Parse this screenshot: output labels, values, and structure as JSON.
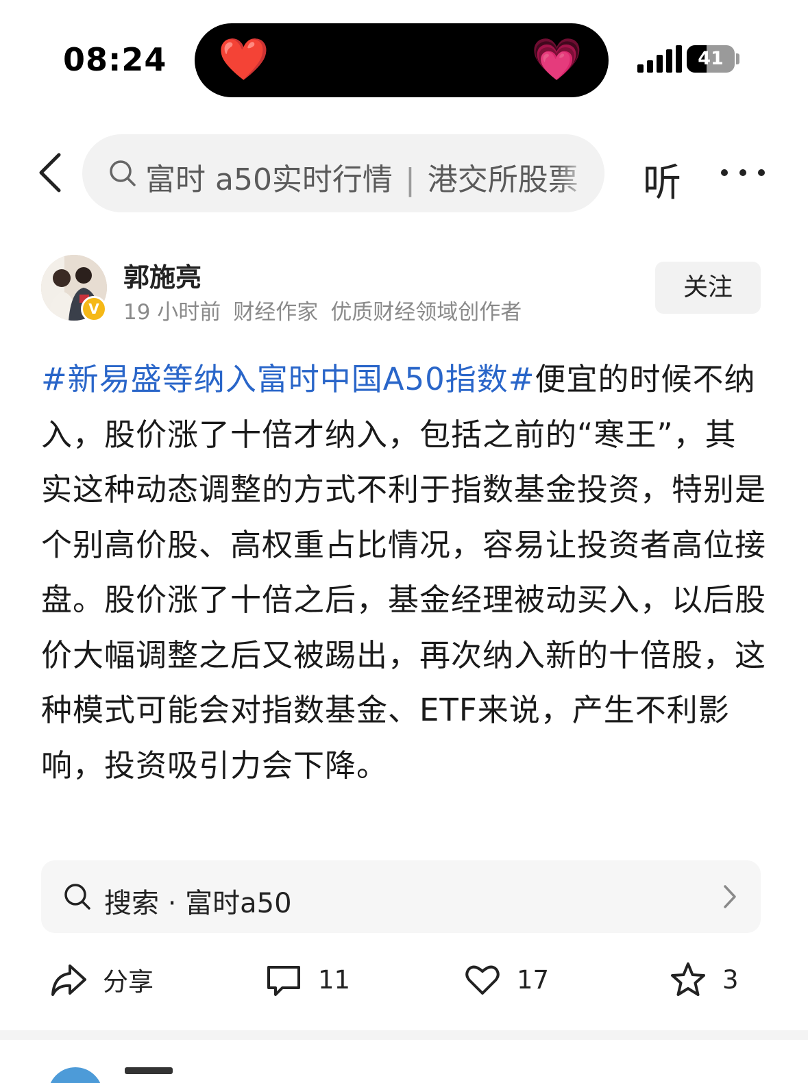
{
  "status_bar": {
    "time": "08:24",
    "battery_level": "41",
    "battery_fraction": 0.41,
    "left_emoji": "❤️",
    "right_emoji": "💗"
  },
  "nav": {
    "search_query": "富时 a50实时行情",
    "search_query_2": "港交所股票",
    "listen_label": "听"
  },
  "author": {
    "name": "郭施亮",
    "time_ago": "19 小时前",
    "title": "财经作家",
    "certification": "优质财经领域创作者",
    "verified_badge": "V",
    "follow_label": "关注"
  },
  "post": {
    "hashtag": "#新易盛等纳入富时中国A50指数#",
    "text": "便宜的时候不纳入，股价涨了十倍才纳入，包括之前的“寒王”，其实这种动态调整的方式不利于指数基金投资，特别是个别高价股、高权重占比情况，容易让投资者高位接盘。股价涨了十倍之后，基金经理被动买入，以后股价大幅调整之后又被踢出，再次纳入新的十倍股，这种模式可能会对指数基金、ETF来说，产生不利影响，投资吸引力会下降。"
  },
  "search_card": {
    "label": "搜索 · 富时a50"
  },
  "actions": {
    "share_label": "分享",
    "comments": "11",
    "likes": "17",
    "favorites": "3"
  },
  "colors": {
    "hashtag": "#2a66c9",
    "badge": "#f5b817"
  }
}
